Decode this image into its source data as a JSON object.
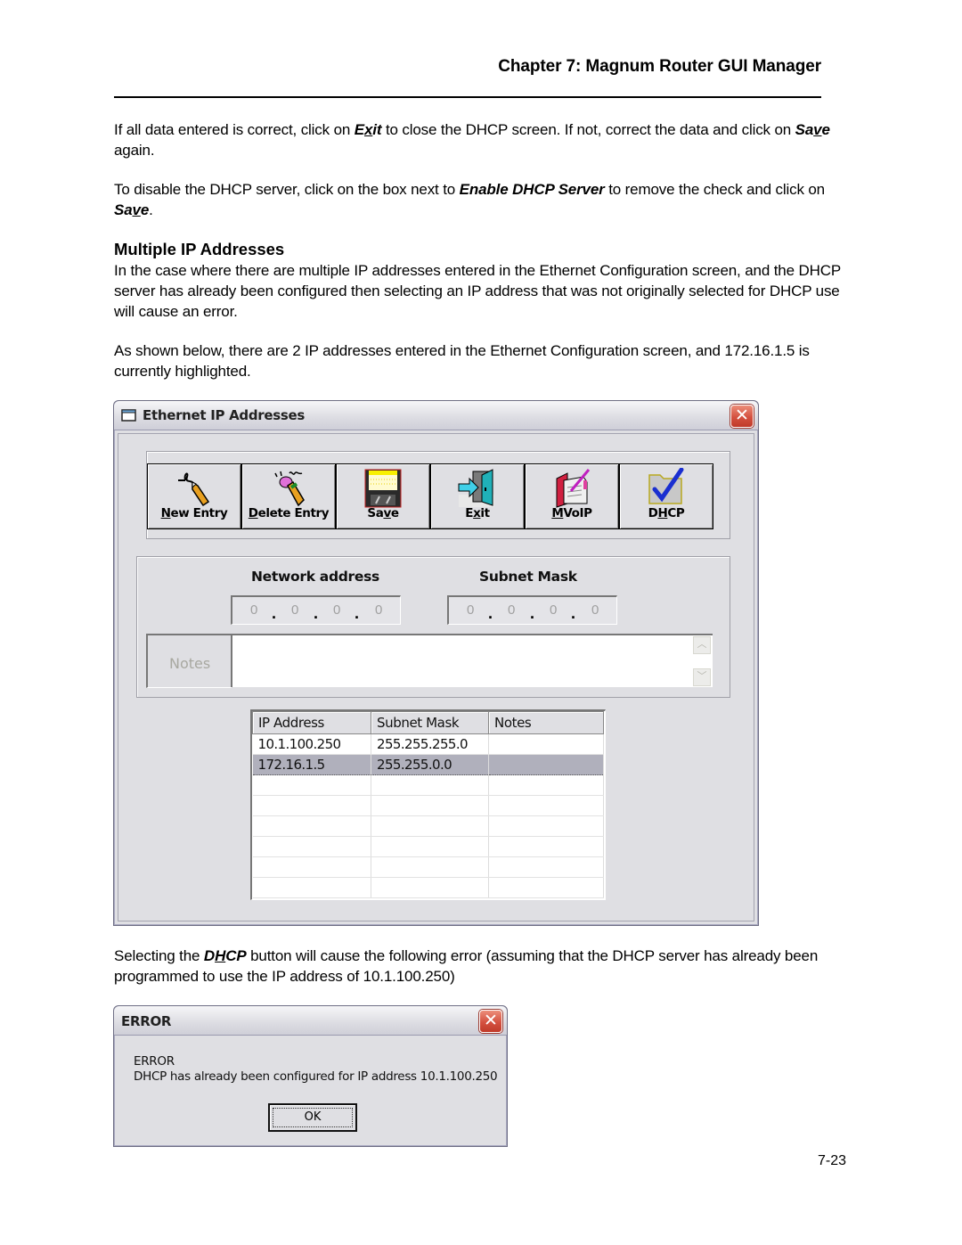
{
  "header": {
    "chapter_title": "Chapter 7: Magnum Router GUI Manager"
  },
  "paragraphs": {
    "p1": {
      "before_exit": "If all data entered is correct, click on ",
      "exit": "Exit",
      "after_exit": " to close the DHCP screen.  If not, correct the data and click on ",
      "save": "Save",
      "end": " again."
    },
    "p2": {
      "before": "To disable the DHCP server, click on the box next to ",
      "enable": "Enable DHCP Server",
      "middle": " to remove the check and click on ",
      "save": "Save",
      "end": "."
    },
    "section_heading": "Multiple IP Addresses",
    "p3": "In the case where there are multiple IP addresses entered in the Ethernet Configuration screen, and the DHCP server has already been configured then selecting an IP address that was not originally selected for DHCP use will cause an error.",
    "p4": "As shown below, there are 2 IP addresses entered in the Ethernet Configuration screen, and 172.16.1.5 is currently highlighted.",
    "p5": {
      "before": "Selecting the ",
      "dhcp": "DHCP",
      "after": " button will cause the following error (assuming that the DHCP server has already been programmed to use the IP address of 10.1.100.250)"
    }
  },
  "ethernet_window": {
    "title": "Ethernet IP Addresses",
    "toolbar": [
      {
        "label": "New Entry",
        "icon": "pencil-write-icon"
      },
      {
        "label": "Delete Entry",
        "icon": "pencil-erase-icon"
      },
      {
        "label": "Save",
        "icon": "floppy-disk-icon"
      },
      {
        "label": "Exit",
        "icon": "exit-door-icon"
      },
      {
        "label": "MVoIP",
        "icon": "notebook-pen-icon"
      },
      {
        "label": "DHCP",
        "icon": "folder-check-icon"
      }
    ],
    "form": {
      "network_address_label": "Network address",
      "subnet_mask_label": "Subnet Mask",
      "network_address_octets": [
        "0",
        "0",
        "0",
        "0"
      ],
      "subnet_mask_octets": [
        "0",
        "0",
        "0",
        "0"
      ],
      "notes_label": "Notes",
      "notes_value": ""
    },
    "table": {
      "columns": [
        "IP Address",
        "Subnet Mask",
        "Notes"
      ],
      "rows": [
        {
          "ip": "10.1.100.250",
          "mask": "255.255.255.0",
          "notes": "",
          "selected": false
        },
        {
          "ip": "172.16.1.5",
          "mask": "255.255.0.0",
          "notes": "",
          "selected": true
        },
        {
          "ip": "",
          "mask": "",
          "notes": "",
          "selected": false
        },
        {
          "ip": "",
          "mask": "",
          "notes": "",
          "selected": false
        },
        {
          "ip": "",
          "mask": "",
          "notes": "",
          "selected": false
        },
        {
          "ip": "",
          "mask": "",
          "notes": "",
          "selected": false
        },
        {
          "ip": "",
          "mask": "",
          "notes": "",
          "selected": false
        },
        {
          "ip": "",
          "mask": "",
          "notes": "",
          "selected": false
        }
      ]
    }
  },
  "error_dialog": {
    "title": "ERROR",
    "line1": "ERROR",
    "line2": "DHCP has already been configured for IP address 10.1.100.250",
    "ok_label": "OK"
  },
  "footer": {
    "page_number": "7-23"
  },
  "colors": {
    "window_bg": "#dfdfe3",
    "selected_row": "#b0b0bc",
    "close_button": "#d45140",
    "check_blue": "#1a2fd0"
  }
}
